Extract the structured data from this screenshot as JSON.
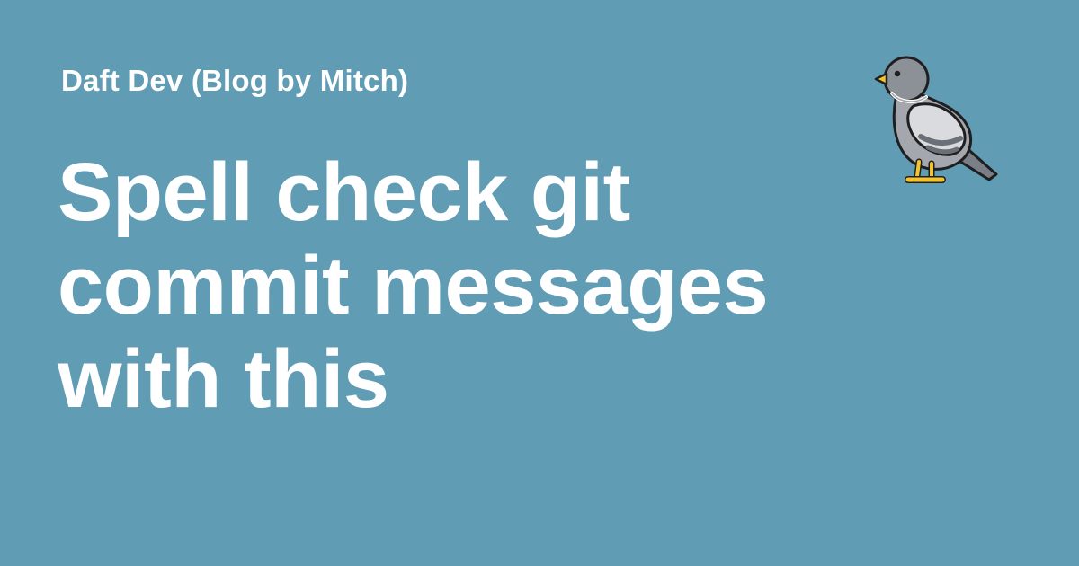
{
  "site": {
    "name": "Daft Dev (Blog by Mitch)"
  },
  "post": {
    "title": "Spell check git commit messages with this"
  },
  "logo": {
    "icon": "pigeon-icon"
  },
  "colors": {
    "background": "#609cb4",
    "text": "#ffffff"
  }
}
